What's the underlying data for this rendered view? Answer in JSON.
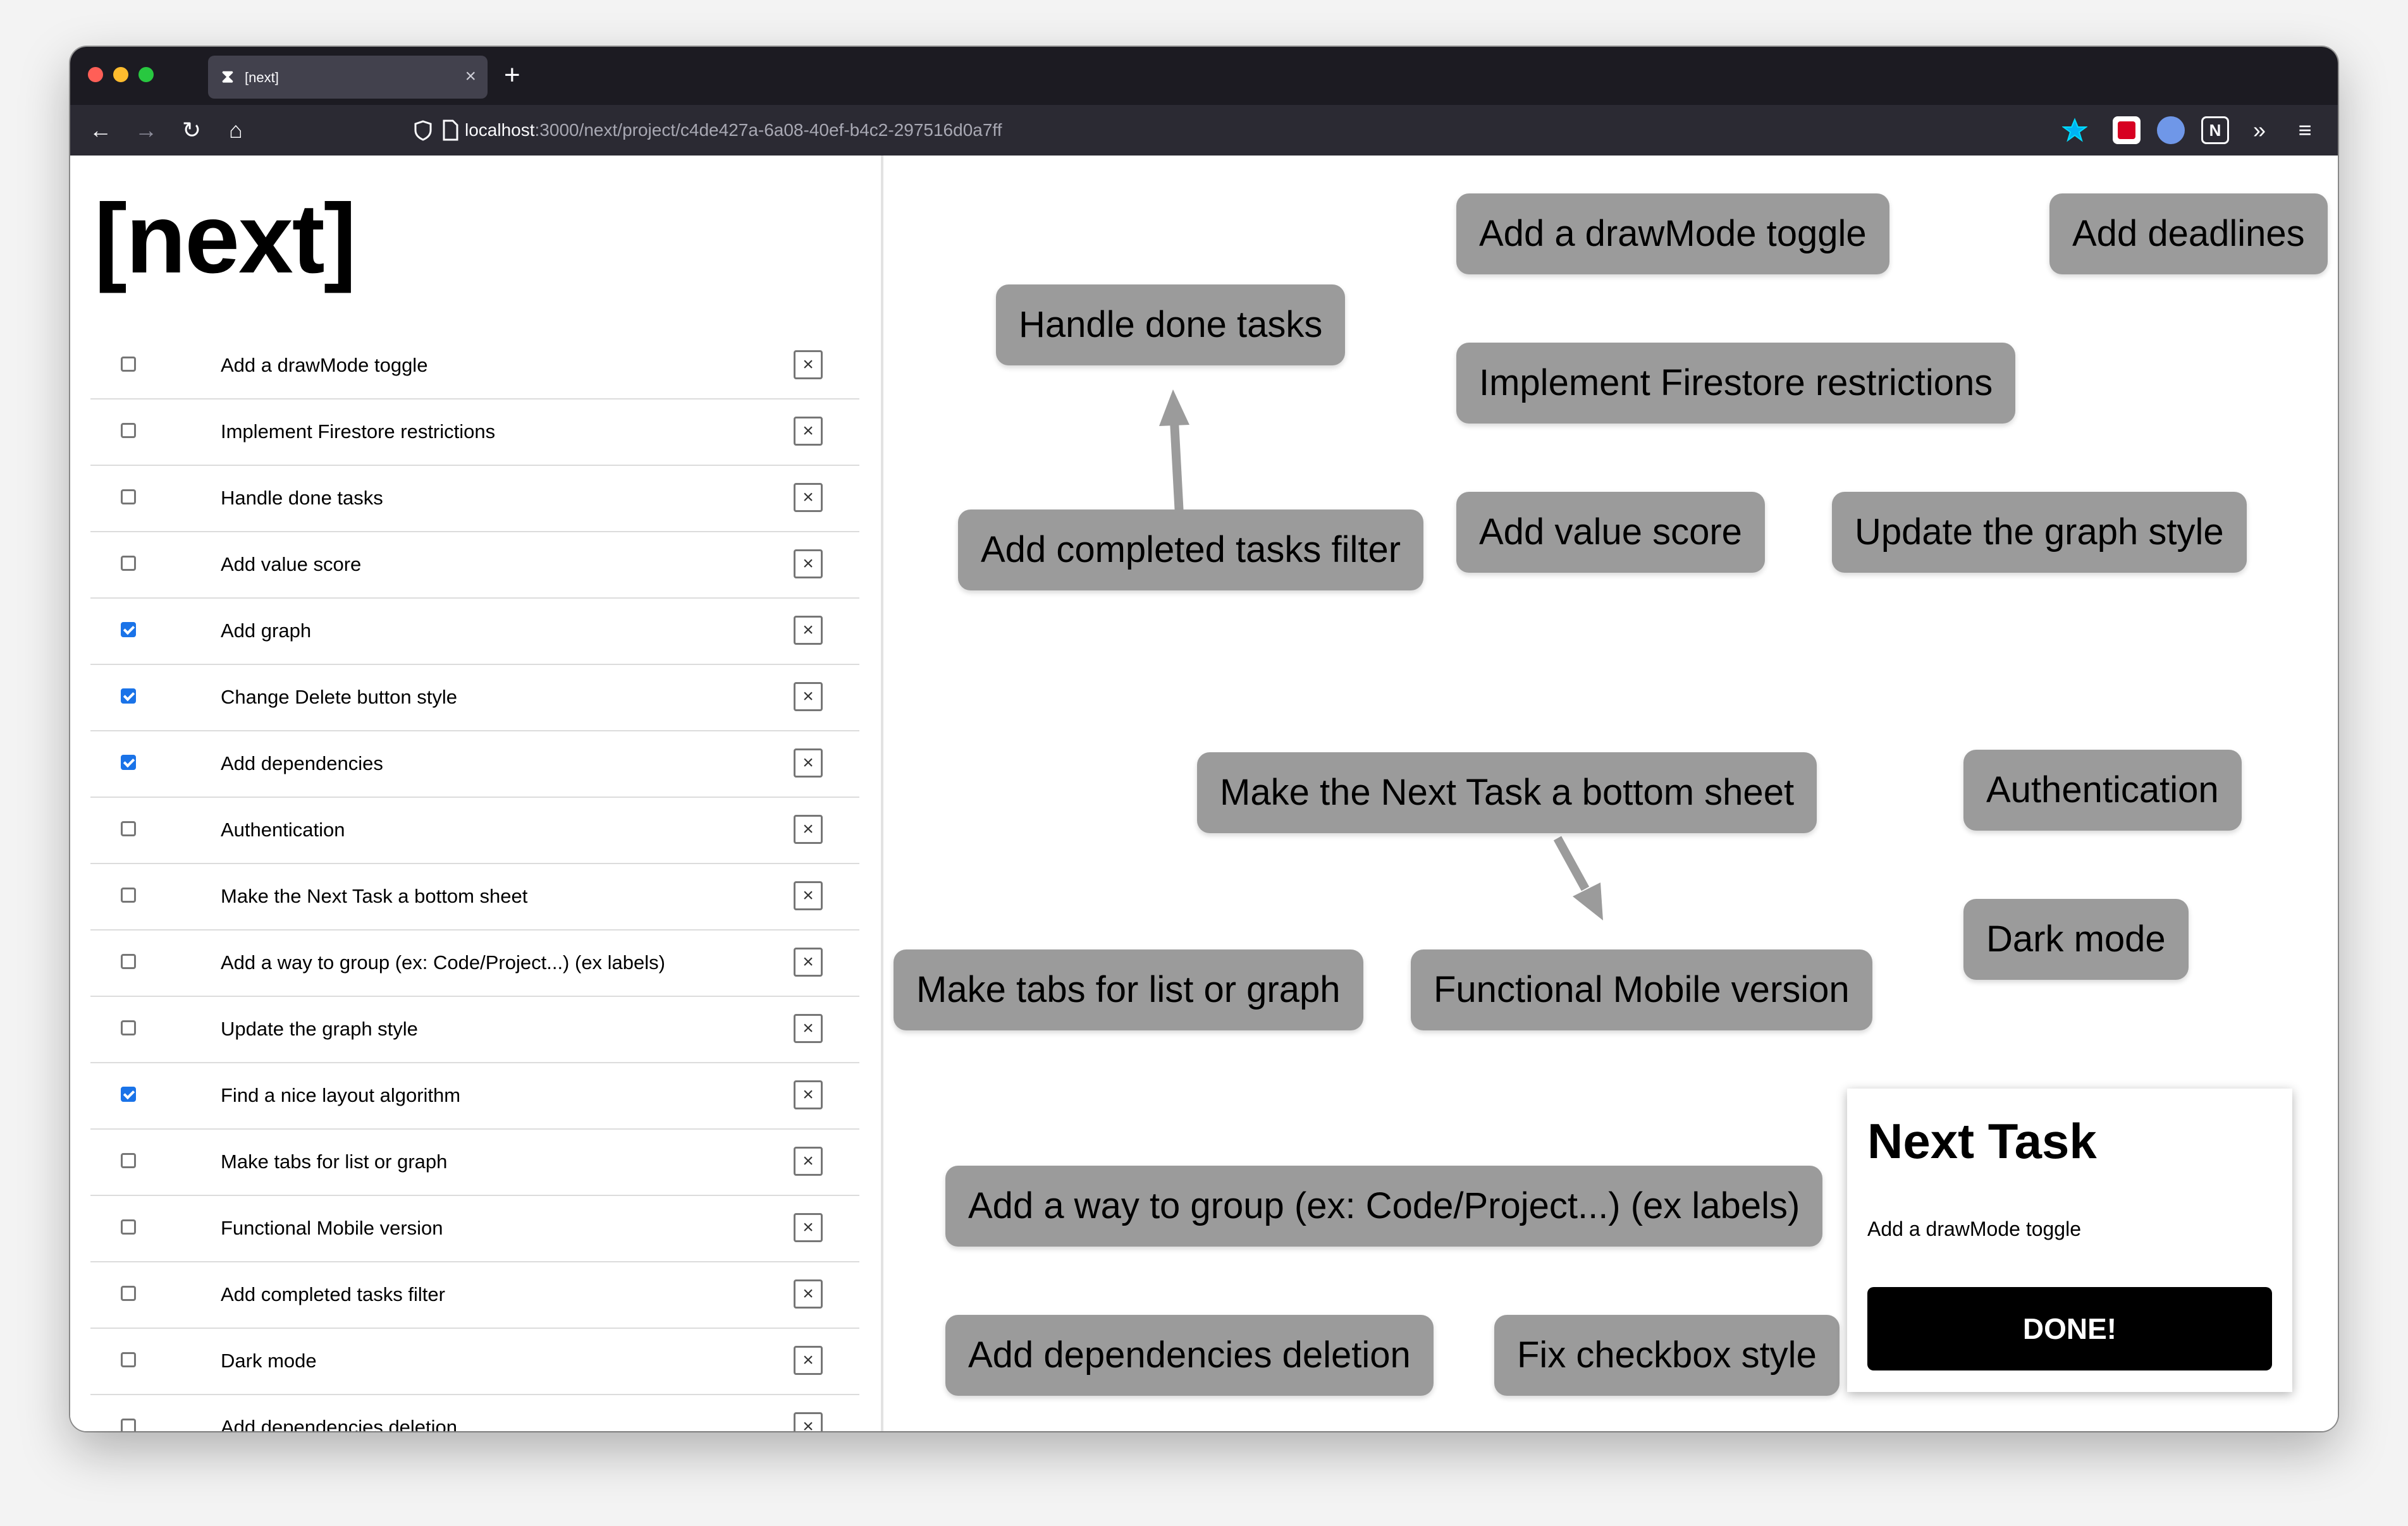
{
  "browser": {
    "tab_title": "[next]",
    "tab_icon": "hourglass-icon",
    "url_host": "localhost",
    "url_path": ":3000/next/project/c4de427a-6a08-40ef-b4c2-297516d0a7ff",
    "new_tab_label": "+",
    "close_tab_label": "×"
  },
  "app": {
    "title": "[next]"
  },
  "tasks": [
    {
      "label": "Add a drawMode toggle",
      "checked": false
    },
    {
      "label": "Implement Firestore restrictions",
      "checked": false
    },
    {
      "label": "Handle done tasks",
      "checked": false
    },
    {
      "label": "Add value score",
      "checked": false
    },
    {
      "label": "Add graph",
      "checked": true
    },
    {
      "label": "Change Delete button style",
      "checked": true
    },
    {
      "label": "Add dependencies",
      "checked": true
    },
    {
      "label": "Authentication",
      "checked": false
    },
    {
      "label": "Make the Next Task a bottom sheet",
      "checked": false
    },
    {
      "label": "Add a way to group (ex: Code/Project...) (ex labels)",
      "checked": false
    },
    {
      "label": "Update the graph style",
      "checked": false
    },
    {
      "label": "Find a nice layout algorithm",
      "checked": true
    },
    {
      "label": "Make tabs for list or graph",
      "checked": false
    },
    {
      "label": "Functional Mobile version",
      "checked": false
    },
    {
      "label": "Add completed tasks filter",
      "checked": false
    },
    {
      "label": "Dark mode",
      "checked": false
    },
    {
      "label": "Add dependencies deletion",
      "checked": false
    }
  ],
  "delete_label": "×",
  "graph": {
    "nodes": [
      "Add a drawMode toggle",
      "Add deadlines",
      "Handle done tasks",
      "Implement Firestore restrictions",
      "Add completed tasks filter",
      "Add value score",
      "Update the graph style",
      "Make the Next Task a bottom sheet",
      "Authentication",
      "Dark mode",
      "Make tabs for list or graph",
      "Functional Mobile version",
      "Add a way to group (ex: Code/Project...) (ex labels)",
      "Add dependencies deletion",
      "Fix checkbox style"
    ],
    "node_color": "#9b9b9b",
    "edge_color": "#9b9b9b"
  },
  "next_task": {
    "heading": "Next Task",
    "task": "Add a drawMode toggle",
    "button": "DONE!"
  }
}
